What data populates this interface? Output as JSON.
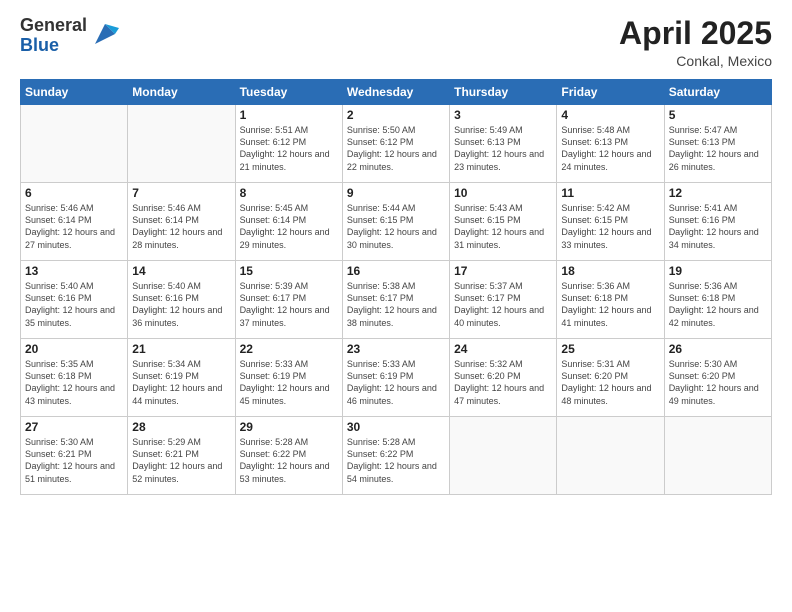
{
  "header": {
    "logo_general": "General",
    "logo_blue": "Blue",
    "month_title": "April 2025",
    "subtitle": "Conkal, Mexico"
  },
  "weekdays": [
    "Sunday",
    "Monday",
    "Tuesday",
    "Wednesday",
    "Thursday",
    "Friday",
    "Saturday"
  ],
  "weeks": [
    [
      {
        "day": null
      },
      {
        "day": null
      },
      {
        "day": "1",
        "sunrise": "Sunrise: 5:51 AM",
        "sunset": "Sunset: 6:12 PM",
        "daylight": "Daylight: 12 hours and 21 minutes."
      },
      {
        "day": "2",
        "sunrise": "Sunrise: 5:50 AM",
        "sunset": "Sunset: 6:12 PM",
        "daylight": "Daylight: 12 hours and 22 minutes."
      },
      {
        "day": "3",
        "sunrise": "Sunrise: 5:49 AM",
        "sunset": "Sunset: 6:13 PM",
        "daylight": "Daylight: 12 hours and 23 minutes."
      },
      {
        "day": "4",
        "sunrise": "Sunrise: 5:48 AM",
        "sunset": "Sunset: 6:13 PM",
        "daylight": "Daylight: 12 hours and 24 minutes."
      },
      {
        "day": "5",
        "sunrise": "Sunrise: 5:47 AM",
        "sunset": "Sunset: 6:13 PM",
        "daylight": "Daylight: 12 hours and 26 minutes."
      }
    ],
    [
      {
        "day": "6",
        "sunrise": "Sunrise: 5:46 AM",
        "sunset": "Sunset: 6:14 PM",
        "daylight": "Daylight: 12 hours and 27 minutes."
      },
      {
        "day": "7",
        "sunrise": "Sunrise: 5:46 AM",
        "sunset": "Sunset: 6:14 PM",
        "daylight": "Daylight: 12 hours and 28 minutes."
      },
      {
        "day": "8",
        "sunrise": "Sunrise: 5:45 AM",
        "sunset": "Sunset: 6:14 PM",
        "daylight": "Daylight: 12 hours and 29 minutes."
      },
      {
        "day": "9",
        "sunrise": "Sunrise: 5:44 AM",
        "sunset": "Sunset: 6:15 PM",
        "daylight": "Daylight: 12 hours and 30 minutes."
      },
      {
        "day": "10",
        "sunrise": "Sunrise: 5:43 AM",
        "sunset": "Sunset: 6:15 PM",
        "daylight": "Daylight: 12 hours and 31 minutes."
      },
      {
        "day": "11",
        "sunrise": "Sunrise: 5:42 AM",
        "sunset": "Sunset: 6:15 PM",
        "daylight": "Daylight: 12 hours and 33 minutes."
      },
      {
        "day": "12",
        "sunrise": "Sunrise: 5:41 AM",
        "sunset": "Sunset: 6:16 PM",
        "daylight": "Daylight: 12 hours and 34 minutes."
      }
    ],
    [
      {
        "day": "13",
        "sunrise": "Sunrise: 5:40 AM",
        "sunset": "Sunset: 6:16 PM",
        "daylight": "Daylight: 12 hours and 35 minutes."
      },
      {
        "day": "14",
        "sunrise": "Sunrise: 5:40 AM",
        "sunset": "Sunset: 6:16 PM",
        "daylight": "Daylight: 12 hours and 36 minutes."
      },
      {
        "day": "15",
        "sunrise": "Sunrise: 5:39 AM",
        "sunset": "Sunset: 6:17 PM",
        "daylight": "Daylight: 12 hours and 37 minutes."
      },
      {
        "day": "16",
        "sunrise": "Sunrise: 5:38 AM",
        "sunset": "Sunset: 6:17 PM",
        "daylight": "Daylight: 12 hours and 38 minutes."
      },
      {
        "day": "17",
        "sunrise": "Sunrise: 5:37 AM",
        "sunset": "Sunset: 6:17 PM",
        "daylight": "Daylight: 12 hours and 40 minutes."
      },
      {
        "day": "18",
        "sunrise": "Sunrise: 5:36 AM",
        "sunset": "Sunset: 6:18 PM",
        "daylight": "Daylight: 12 hours and 41 minutes."
      },
      {
        "day": "19",
        "sunrise": "Sunrise: 5:36 AM",
        "sunset": "Sunset: 6:18 PM",
        "daylight": "Daylight: 12 hours and 42 minutes."
      }
    ],
    [
      {
        "day": "20",
        "sunrise": "Sunrise: 5:35 AM",
        "sunset": "Sunset: 6:18 PM",
        "daylight": "Daylight: 12 hours and 43 minutes."
      },
      {
        "day": "21",
        "sunrise": "Sunrise: 5:34 AM",
        "sunset": "Sunset: 6:19 PM",
        "daylight": "Daylight: 12 hours and 44 minutes."
      },
      {
        "day": "22",
        "sunrise": "Sunrise: 5:33 AM",
        "sunset": "Sunset: 6:19 PM",
        "daylight": "Daylight: 12 hours and 45 minutes."
      },
      {
        "day": "23",
        "sunrise": "Sunrise: 5:33 AM",
        "sunset": "Sunset: 6:19 PM",
        "daylight": "Daylight: 12 hours and 46 minutes."
      },
      {
        "day": "24",
        "sunrise": "Sunrise: 5:32 AM",
        "sunset": "Sunset: 6:20 PM",
        "daylight": "Daylight: 12 hours and 47 minutes."
      },
      {
        "day": "25",
        "sunrise": "Sunrise: 5:31 AM",
        "sunset": "Sunset: 6:20 PM",
        "daylight": "Daylight: 12 hours and 48 minutes."
      },
      {
        "day": "26",
        "sunrise": "Sunrise: 5:30 AM",
        "sunset": "Sunset: 6:20 PM",
        "daylight": "Daylight: 12 hours and 49 minutes."
      }
    ],
    [
      {
        "day": "27",
        "sunrise": "Sunrise: 5:30 AM",
        "sunset": "Sunset: 6:21 PM",
        "daylight": "Daylight: 12 hours and 51 minutes."
      },
      {
        "day": "28",
        "sunrise": "Sunrise: 5:29 AM",
        "sunset": "Sunset: 6:21 PM",
        "daylight": "Daylight: 12 hours and 52 minutes."
      },
      {
        "day": "29",
        "sunrise": "Sunrise: 5:28 AM",
        "sunset": "Sunset: 6:22 PM",
        "daylight": "Daylight: 12 hours and 53 minutes."
      },
      {
        "day": "30",
        "sunrise": "Sunrise: 5:28 AM",
        "sunset": "Sunset: 6:22 PM",
        "daylight": "Daylight: 12 hours and 54 minutes."
      },
      {
        "day": null
      },
      {
        "day": null
      },
      {
        "day": null
      }
    ]
  ]
}
